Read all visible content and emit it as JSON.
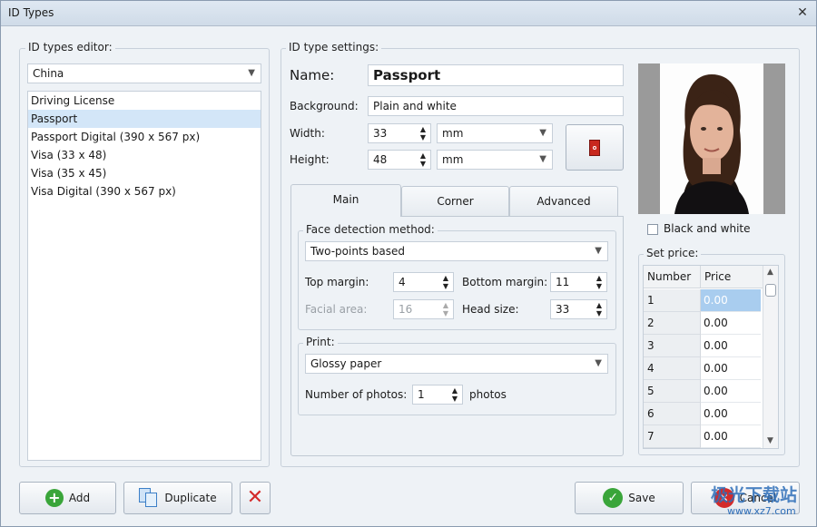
{
  "window": {
    "title": "ID Types",
    "close_glyph": "✕"
  },
  "editor": {
    "label": "ID types editor:",
    "country": "China",
    "items": [
      "Driving License",
      "Passport",
      "Passport Digital (390 x 567 px)",
      "Visa (33 x 48)",
      "Visa (35 x 45)",
      "Visa Digital (390 x 567 px)"
    ],
    "selected_index": 1
  },
  "settings": {
    "label": "ID type settings:",
    "name_label": "Name:",
    "name_value": "Passport",
    "background_label": "Background:",
    "background_value": "Plain and white",
    "width_label": "Width:",
    "width_value": "33",
    "width_unit": "mm",
    "height_label": "Height:",
    "height_value": "48",
    "height_unit": "mm"
  },
  "tabs": [
    "Main",
    "Corner",
    "Advanced"
  ],
  "main": {
    "face_label": "Face detection method:",
    "face_method": "Two-points based",
    "top_margin_label": "Top margin:",
    "top_margin": "4",
    "bottom_margin_label": "Bottom margin:",
    "bottom_margin": "11",
    "facial_area_label": "Facial area:",
    "facial_area": "16",
    "head_size_label": "Head size:",
    "head_size": "33",
    "print_label": "Print:",
    "paper": "Glossy paper",
    "photos_label": "Number of photos:",
    "photos_value": "1",
    "photos_suffix": "photos"
  },
  "photo": {
    "bw_label": "Black and white"
  },
  "price": {
    "label": "Set price:",
    "col_number": "Number",
    "col_price": "Price",
    "rows": [
      {
        "n": "1",
        "p": "0.00"
      },
      {
        "n": "2",
        "p": "0.00"
      },
      {
        "n": "3",
        "p": "0.00"
      },
      {
        "n": "4",
        "p": "0.00"
      },
      {
        "n": "5",
        "p": "0.00"
      },
      {
        "n": "6",
        "p": "0.00"
      },
      {
        "n": "7",
        "p": "0.00"
      }
    ]
  },
  "buttons": {
    "add": "Add",
    "duplicate": "Duplicate",
    "save": "Save",
    "cancel": "Cancel"
  },
  "watermark": {
    "text": "极光下载站",
    "url": "www.xz7.com"
  },
  "colors": {
    "accent_green": "#3aa53a",
    "delete_red": "#d42a2a",
    "selection": "#d3e6f8"
  }
}
